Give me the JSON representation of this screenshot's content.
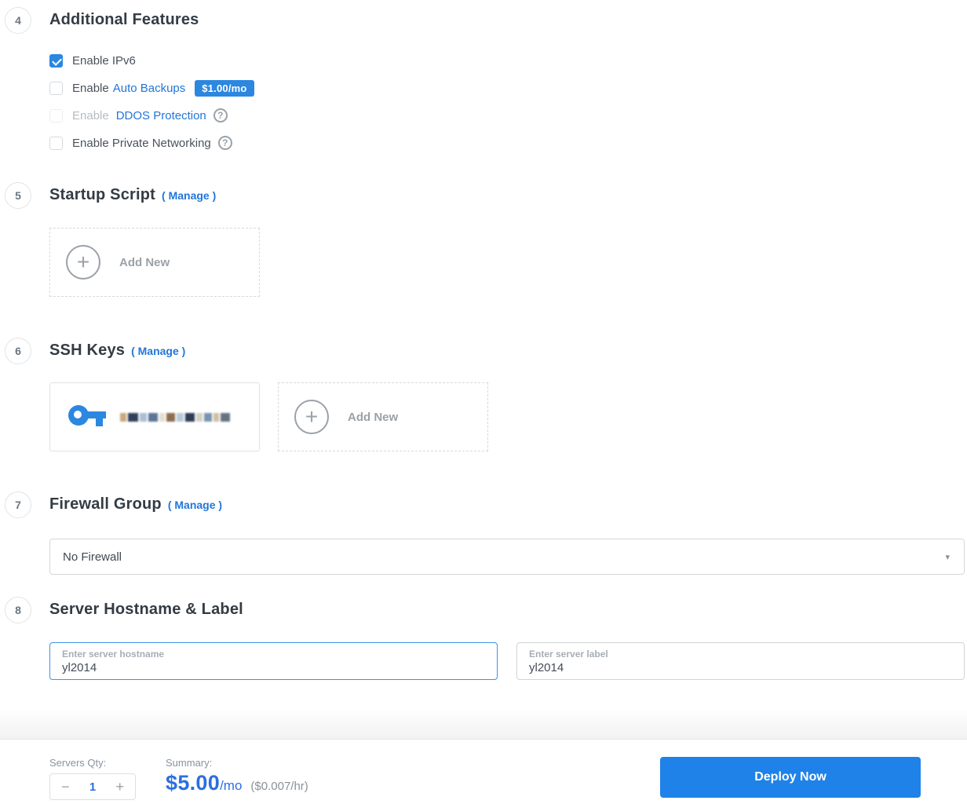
{
  "colors": {
    "accent": "#2b87e0",
    "deploy_blue": "#1e82e8",
    "price_blue": "#2b6fe0",
    "link_blue": "#2376d8"
  },
  "icons": {
    "help": "?",
    "plus": "+",
    "caret": "▾"
  },
  "sections": {
    "features": {
      "step": "4",
      "title": "Additional Features",
      "ipv6_label": "Enable IPv6",
      "backups_prefix": "Enable",
      "backups_link": "Auto Backups",
      "backups_badge": "$1.00/mo",
      "ddos_prefix": "Enable",
      "ddos_link": "DDOS Protection",
      "private_label": "Enable Private Networking"
    },
    "startup": {
      "step": "5",
      "title": "Startup Script",
      "manage": "( Manage )",
      "add_new": "Add New"
    },
    "ssh": {
      "step": "6",
      "title": "SSH Keys",
      "manage": "( Manage )",
      "add_new": "Add New"
    },
    "firewall": {
      "step": "7",
      "title": "Firewall Group",
      "manage": "( Manage )",
      "selected": "No Firewall"
    },
    "host": {
      "step": "8",
      "title": "Server Hostname & Label",
      "hostname_label": "Enter server hostname",
      "hostname_value": "yl2014",
      "label_label": "Enter server label",
      "label_value": "yl2014"
    }
  },
  "footer": {
    "qty_label": "Servers Qty:",
    "qty_minus": "−",
    "qty_value": "1",
    "qty_plus": "+",
    "summary_label": "Summary:",
    "price": "$5.00",
    "per": "/mo",
    "hourly": "($0.007/hr)",
    "deploy": "Deploy Now"
  }
}
